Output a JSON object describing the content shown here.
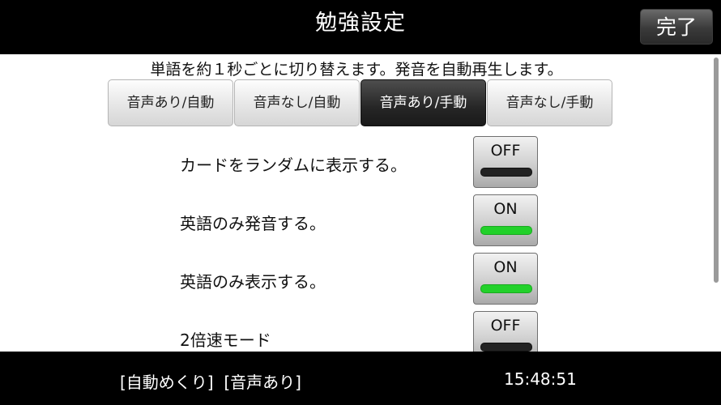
{
  "header": {
    "title": "勉強設定",
    "done_label": "完了"
  },
  "description": "単語を約１秒ごとに切り替えます。発音を自動再生します。",
  "mode_tabs": [
    {
      "label": "音声あり/自動",
      "active": false
    },
    {
      "label": "音声なし/自動",
      "active": false
    },
    {
      "label": "音声あり/手動",
      "active": true
    },
    {
      "label": "音声なし/手動",
      "active": false
    }
  ],
  "settings": [
    {
      "label": "カードをランダムに表示する。",
      "state": "OFF"
    },
    {
      "label": "英語のみ発音する。",
      "state": "ON"
    },
    {
      "label": "英語のみ表示する。",
      "state": "ON"
    },
    {
      "label": "2倍速モード",
      "state": "OFF"
    }
  ],
  "status": {
    "mode_text": "[自動めくり]  [音声あり]",
    "time": "15:48:51"
  },
  "colors": {
    "on_indicator": "#22d12a",
    "off_indicator": "#222222",
    "active_tab": "#262626"
  }
}
